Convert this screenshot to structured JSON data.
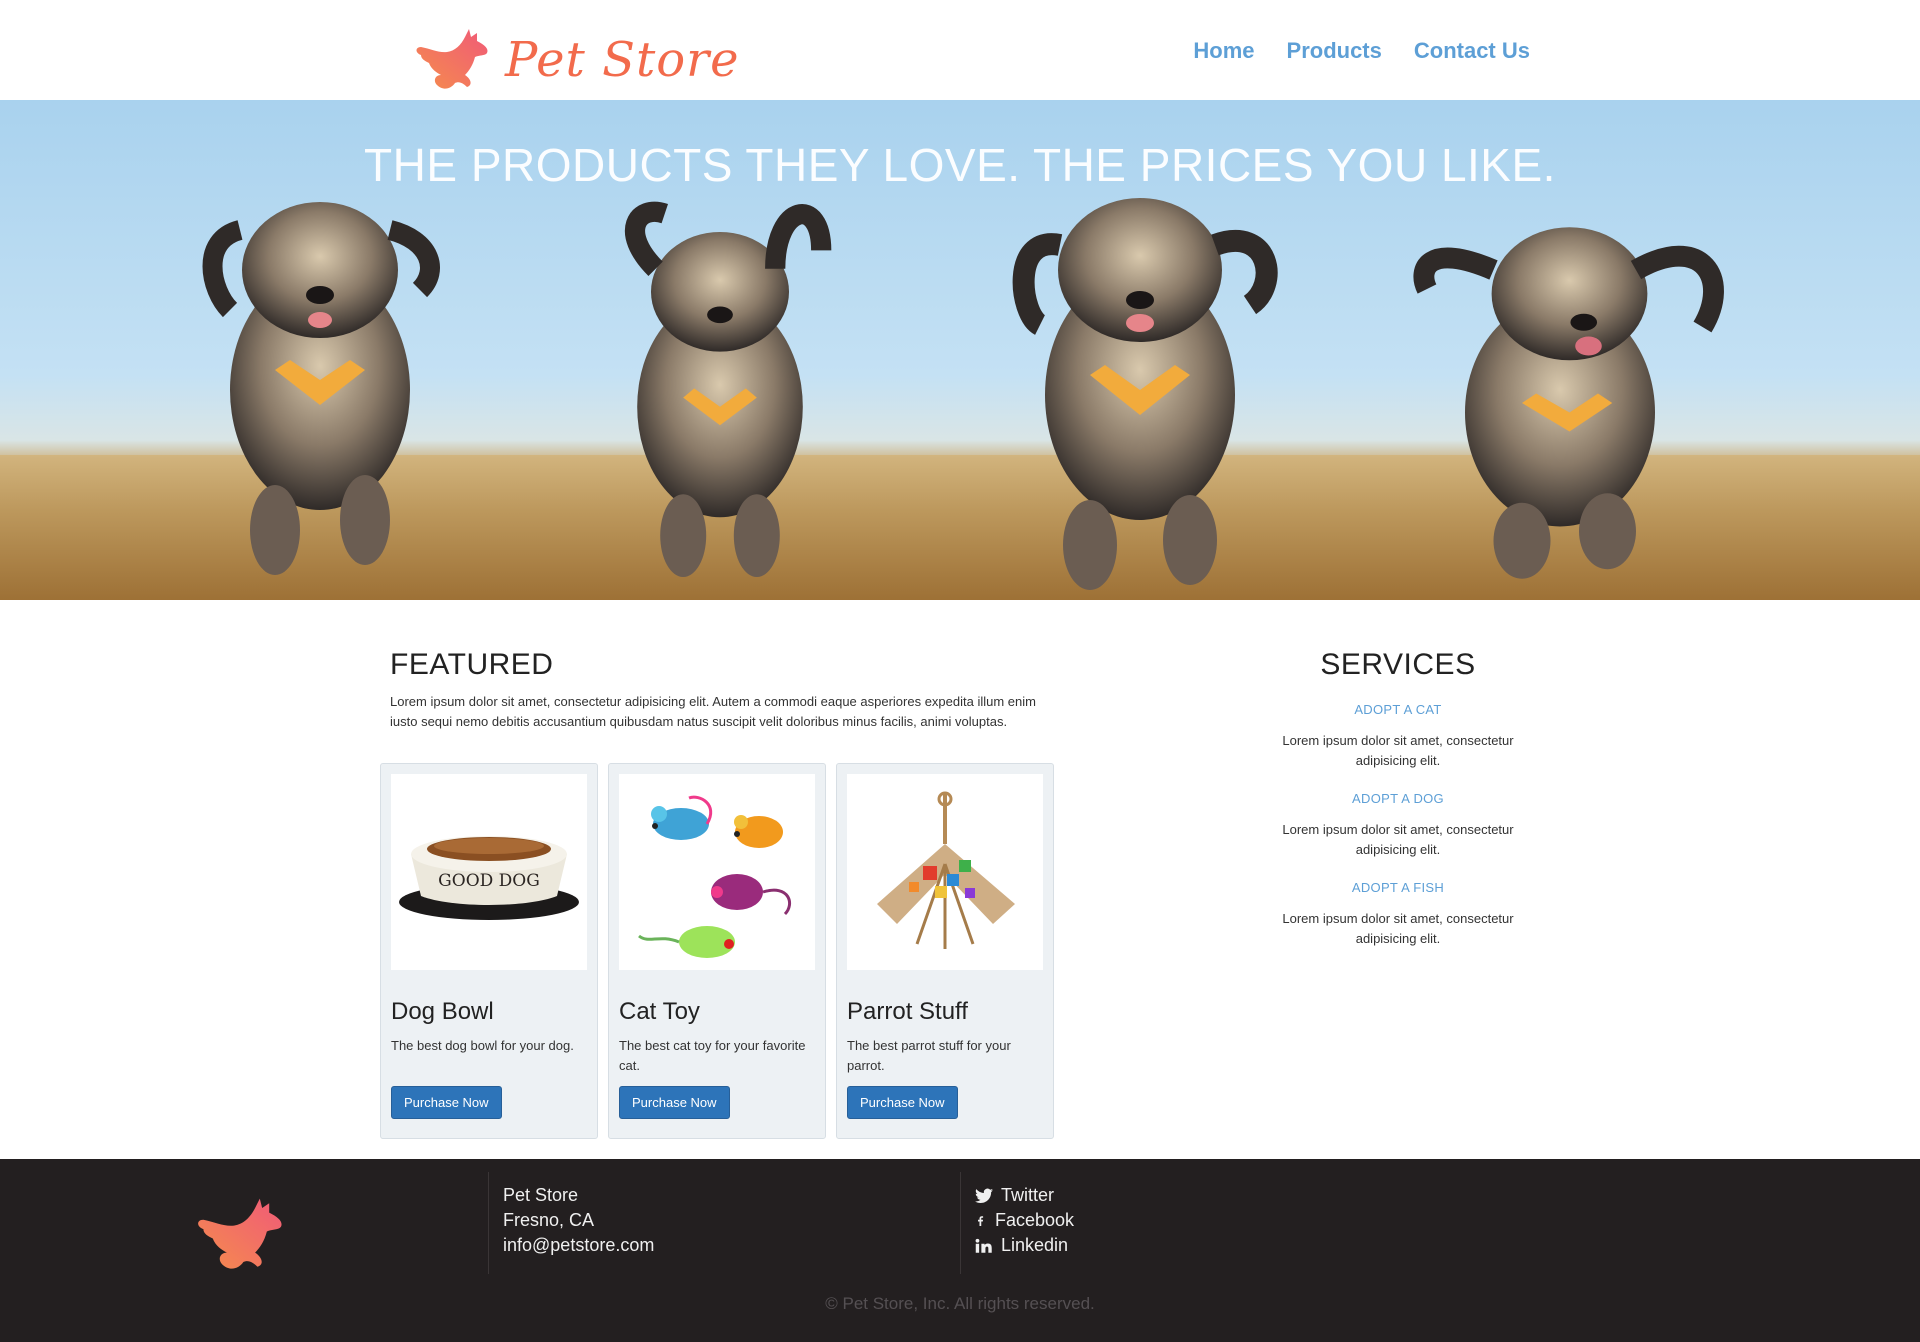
{
  "brand": {
    "name": "Pet Store",
    "logo_icon": "dog-icon",
    "color": "#f26b4c"
  },
  "nav": {
    "items": [
      "Home",
      "Products",
      "Contact Us"
    ],
    "color": "#5d9fd6"
  },
  "hero": {
    "title": "THE PRODUCTS THEY LOVE. THE PRICES YOU LIKE.",
    "image": "four-dogs-running-in-field"
  },
  "featured": {
    "title": "FEATURED",
    "text": "Lorem ipsum dolor sit amet, consectetur adipisicing elit. Autem a commodi eaque asperiores expedita illum enim iusto sequi nemo debitis accusantium quibusdam natus suscipit velit doloribus minus facilis, animi voluptas.",
    "products": [
      {
        "name": "Dog Bowl",
        "description": "The best dog bowl for your dog.",
        "button": "Purchase Now",
        "image": "dog-bowl-image",
        "image_text": "GOOD DOG"
      },
      {
        "name": "Cat Toy",
        "description": "The best cat toy for your favorite cat.",
        "button": "Purchase Now",
        "image": "cat-toy-mice-image"
      },
      {
        "name": "Parrot Stuff",
        "description": "The best parrot stuff for your parrot.",
        "button": "Purchase Now",
        "image": "parrot-toy-image"
      }
    ]
  },
  "services": {
    "title": "SERVICES",
    "items": [
      {
        "link": "ADOPT A CAT",
        "text": "Lorem ipsum dolor sit amet, consectetur adipisicing elit."
      },
      {
        "link": "ADOPT A DOG",
        "text": "Lorem ipsum dolor sit amet, consectetur adipisicing elit."
      },
      {
        "link": "ADOPT A FISH",
        "text": "Lorem ipsum dolor sit amet, consectetur adipisicing elit."
      }
    ]
  },
  "footer": {
    "address": [
      "Pet Store",
      "Fresno, CA",
      "info@petstore.com"
    ],
    "social": [
      {
        "label": "Twitter",
        "icon": "twitter-icon"
      },
      {
        "label": "Facebook",
        "icon": "facebook-icon"
      },
      {
        "label": "Linkedin",
        "icon": "linkedin-icon"
      }
    ],
    "copyright": "© Pet Store, Inc. All rights reserved.",
    "background": "#231f20"
  },
  "colors": {
    "button": "#2d74b9",
    "link": "#5d9fd6",
    "card_bg": "#edf1f4"
  }
}
